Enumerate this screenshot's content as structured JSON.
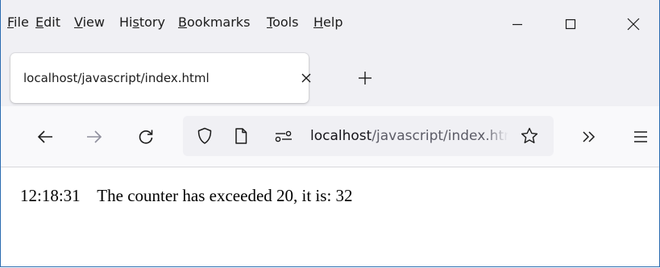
{
  "menu": {
    "items": [
      {
        "pre": "",
        "key": "F",
        "post": "ile"
      },
      {
        "pre": "",
        "key": "E",
        "post": "dit"
      },
      {
        "pre": "",
        "key": "V",
        "post": "iew"
      },
      {
        "pre": "Hi",
        "key": "s",
        "post": "tory"
      },
      {
        "pre": "",
        "key": "B",
        "post": "ookmarks"
      },
      {
        "pre": "",
        "key": "T",
        "post": "ools"
      },
      {
        "pre": "",
        "key": "H",
        "post": "elp"
      }
    ]
  },
  "window_controls": {
    "minimize_icon": "minimize-icon",
    "maximize_icon": "maximize-icon",
    "close_icon": "close-icon"
  },
  "tab": {
    "title": "localhost/javascript/index.html",
    "close_icon": "close-icon",
    "new_tab_icon": "plus-icon"
  },
  "navbar": {
    "back_icon": "arrow-left-icon",
    "forward_icon": "arrow-right-icon",
    "reload_icon": "reload-icon",
    "shield_icon": "shield-icon",
    "page_icon": "page-icon",
    "permissions_icon": "permissions-icon",
    "url_host": "localhost",
    "url_path": "/javascript/index.html",
    "bookmark_icon": "star-icon",
    "overflow_icon": "chevrons-right-icon",
    "menu_icon": "hamburger-menu-icon"
  },
  "page": {
    "time": "12:18:31",
    "message": "The counter has exceeded 20, it is: 32"
  },
  "colors": {
    "chrome_bg": "#f0f0f4",
    "navbar_bg": "#f9f9fb",
    "window_border": "#2b6cb0",
    "icon": "#1b1b1b",
    "disabled_icon": "#8f8f9d"
  }
}
